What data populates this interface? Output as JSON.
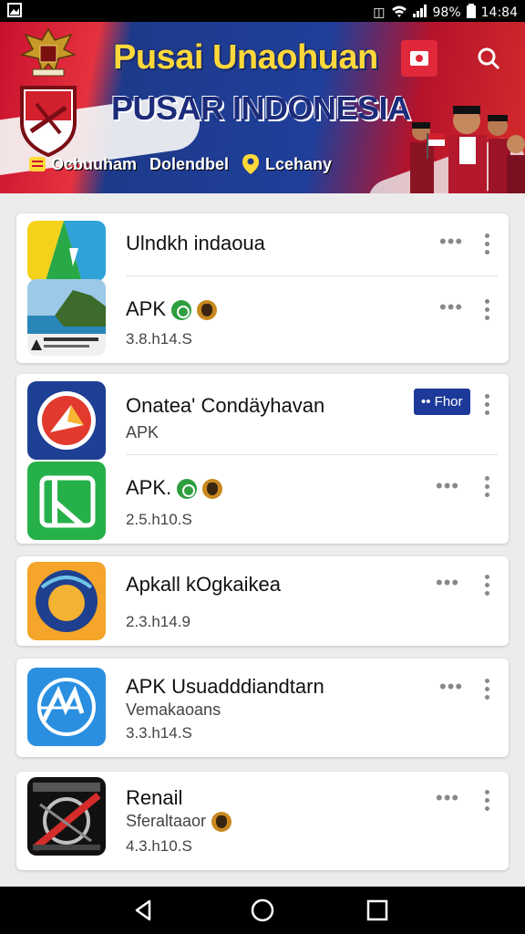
{
  "status": {
    "battery": "98%",
    "time": "14:84"
  },
  "banner": {
    "title_line1": "Pusai Unaohuan",
    "title_line2": "PUSAR INDONESIA",
    "nav": [
      "Ocbuuham",
      "Dolendbel",
      "Lcehany"
    ]
  },
  "apps": [
    {
      "title": "Ulndkh indaoua",
      "rows": [
        {
          "title": "APK",
          "meta": "3.8.h14.S"
        }
      ]
    },
    {
      "title": "Onatea' Condäyhavan",
      "sub": "APK",
      "chip": "•• Fhor",
      "rows": [
        {
          "title": "APK.",
          "meta": "2.5.h10.S"
        }
      ]
    },
    {
      "title": "Apkall kOgkaikea",
      "meta": "2.3.h14.9"
    },
    {
      "title": "APK Usuadddiandtarn",
      "sub": "Vemakaoans",
      "meta": "3.3.h14.S"
    },
    {
      "title": "Renail",
      "sub": "Sferaltaaor",
      "meta": "4.3.h10.S"
    }
  ]
}
